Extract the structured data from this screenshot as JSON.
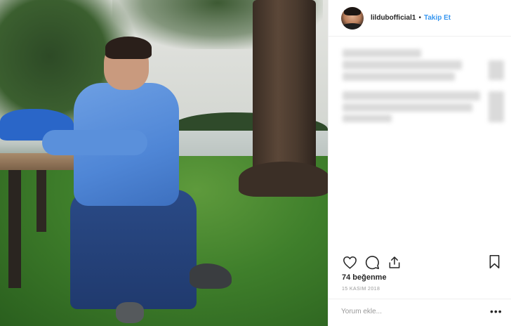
{
  "post": {
    "username": "lildubofficial1",
    "separator": "•",
    "follow_label": "Takip Et",
    "likes_text": "74 beğenme",
    "date_text": "15 KASIM 2018",
    "comment_placeholder": "Yorum ekle...",
    "more_label": "•••"
  },
  "icons": {
    "like": "heart-icon",
    "comment": "comment-icon",
    "share": "share-icon",
    "save": "bookmark-icon",
    "more": "more-options-icon"
  },
  "colors": {
    "link_blue": "#3897f0",
    "text": "#262626",
    "muted": "#999999",
    "border": "#efefef"
  }
}
